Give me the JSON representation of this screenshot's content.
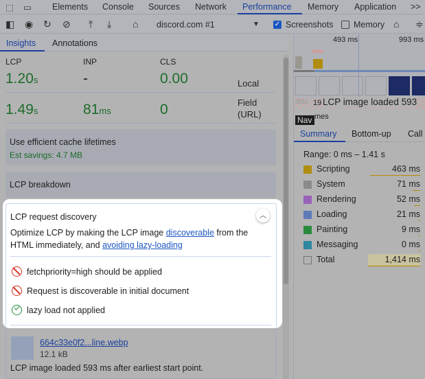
{
  "tabs": {
    "items": [
      "Elements",
      "Console",
      "Sources",
      "Network",
      "Performance",
      "Memory",
      "Application"
    ],
    "active": "Performance",
    "more": ">>"
  },
  "toolbar": {
    "recording": "discord.com #1",
    "screenshots_label": "Screenshots",
    "screenshots_checked": true,
    "memory_label": "Memory",
    "memory_checked": false
  },
  "subtabs": {
    "insights": "Insights",
    "annotations": "Annotations"
  },
  "metrics": {
    "headers": [
      "LCP",
      "INP",
      "CLS"
    ],
    "local": {
      "label": "Local",
      "lcp": "1.20",
      "lcp_unit": "s",
      "inp": "-",
      "cls": "0.00"
    },
    "field": {
      "label1": "Field",
      "label2": "(URL)",
      "lcp": "1.49",
      "lcp_unit": "s",
      "inp": "81",
      "inp_unit": "ms",
      "cls": "0"
    }
  },
  "cards": {
    "cache": {
      "title": "Use efficient cache lifetimes",
      "savings": "Est savings: 4.7 MB"
    },
    "breakdown": {
      "title": "LCP breakdown"
    }
  },
  "discovery": {
    "title": "LCP request discovery",
    "desc_1": "Optimize LCP by making the LCP image ",
    "link_1": "discoverable",
    "desc_2": " from the HTML immediately, and ",
    "link_2": "avoiding lazy-loading",
    "checks": [
      {
        "text": "fetchpriority=high should be applied",
        "status": "fail"
      },
      {
        "text": "Request is discoverable in initial document",
        "status": "fail"
      },
      {
        "text": "lazy load not applied",
        "status": "pass"
      }
    ],
    "file": {
      "name": "664c33e0f2...line.webp",
      "size": "12.1 kB"
    },
    "note": "LCP image loaded 593 ms after earliest start point."
  },
  "timeline": {
    "tick1": "493 ms",
    "tick2": "993 ms",
    "lcp_marker": "LCP image loaded 593",
    "disc": "disc",
    "nineteen": "19",
    "nav": "Nav",
    "frames": "mes"
  },
  "summary": {
    "tabs": [
      "Summary",
      "Bottom-up",
      "Call"
    ],
    "range": "Range: 0 ms – 1.41 s",
    "rows": [
      {
        "name": "Scripting",
        "value": "463 ms",
        "color": "#b08d10",
        "pct": 0.33
      },
      {
        "name": "System",
        "value": "71 ms",
        "color": "#8a8a8a",
        "pct": 0.05
      },
      {
        "name": "Rendering",
        "value": "52 ms",
        "color": "#9a62b8",
        "pct": 0.04
      },
      {
        "name": "Loading",
        "value": "21 ms",
        "color": "#5d7bb8",
        "pct": 0.015
      },
      {
        "name": "Painting",
        "value": "9 ms",
        "color": "#2a8a3c",
        "pct": 0.01
      },
      {
        "name": "Messaging",
        "value": "0 ms",
        "color": "#2e86a0",
        "pct": 0
      }
    ],
    "total": {
      "name": "Total",
      "value": "1,414 ms"
    }
  }
}
